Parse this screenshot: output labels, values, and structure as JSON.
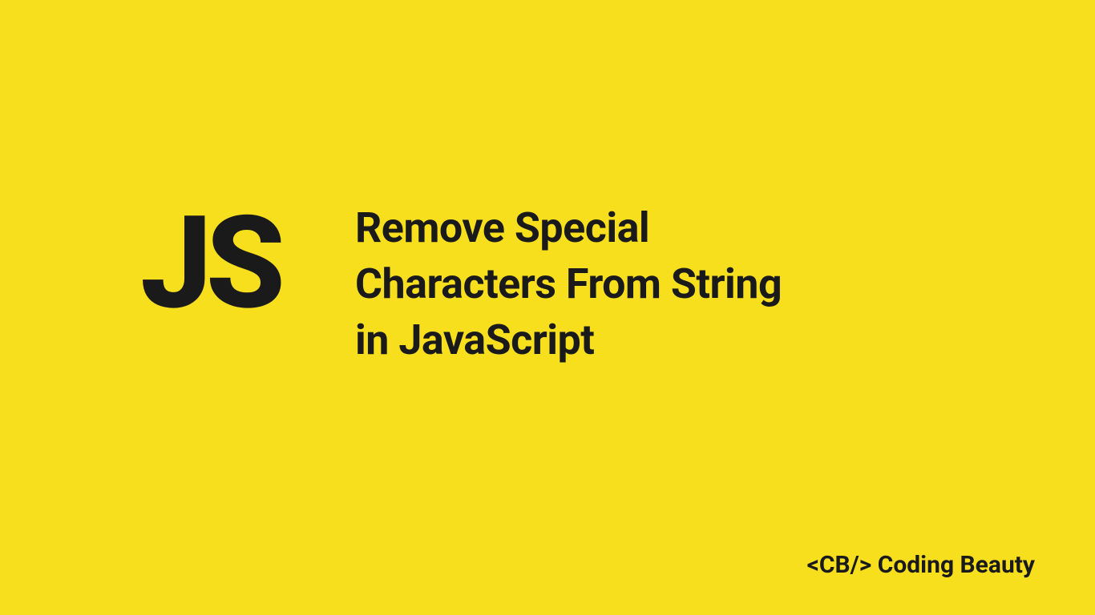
{
  "badge": "JS",
  "title_line1": "Remove Special",
  "title_line2": "Characters From String",
  "title_line3": "in JavaScript",
  "footer_tag": "<CB/>",
  "footer_text": "Coding Beauty",
  "colors": {
    "background": "#f7df1e",
    "text": "#1a1a1a"
  }
}
